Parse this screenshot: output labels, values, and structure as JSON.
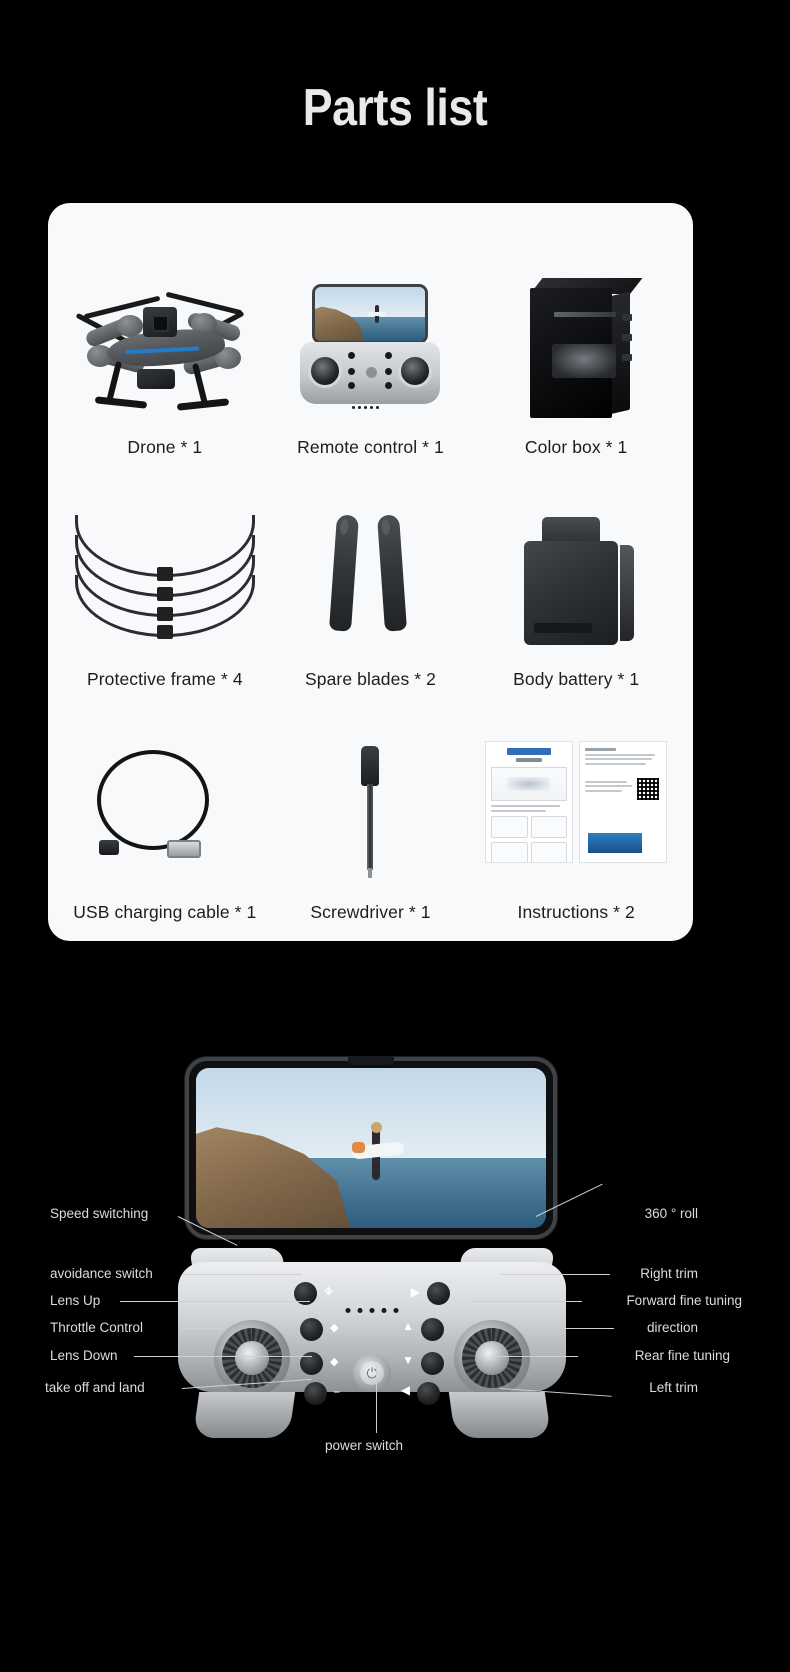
{
  "page": {
    "title": "Parts list",
    "background_color": "#000000",
    "card_color": "#f8f9fb"
  },
  "parts": [
    {
      "label": "Drone * 1",
      "icon": "drone-icon"
    },
    {
      "label": "Remote control * 1",
      "icon": "remote-control-icon"
    },
    {
      "label": "Color box * 1",
      "icon": "color-box-icon"
    },
    {
      "label": "Protective frame * 4",
      "icon": "propeller-guard-icon"
    },
    {
      "label": "Spare blades * 2",
      "icon": "spare-blades-icon"
    },
    {
      "label": "Body battery * 1",
      "icon": "battery-icon"
    },
    {
      "label": "USB charging cable * 1",
      "icon": "usb-cable-icon"
    },
    {
      "label": "Screwdriver * 1",
      "icon": "screwdriver-icon"
    },
    {
      "label": "Instructions * 2",
      "icon": "manual-icon"
    }
  ],
  "controller": {
    "power_switch_label": "power switch",
    "left_callouts": [
      "Speed switching",
      "avoidance switch",
      "Lens Up",
      "Throttle Control",
      "Lens Down",
      "take off and land"
    ],
    "right_callouts": [
      "360 ° roll",
      "Right trim",
      "Forward fine tuning",
      "direction",
      "Rear fine tuning",
      "Left trim"
    ],
    "power_icon": "power-icon",
    "led_count": 5
  }
}
